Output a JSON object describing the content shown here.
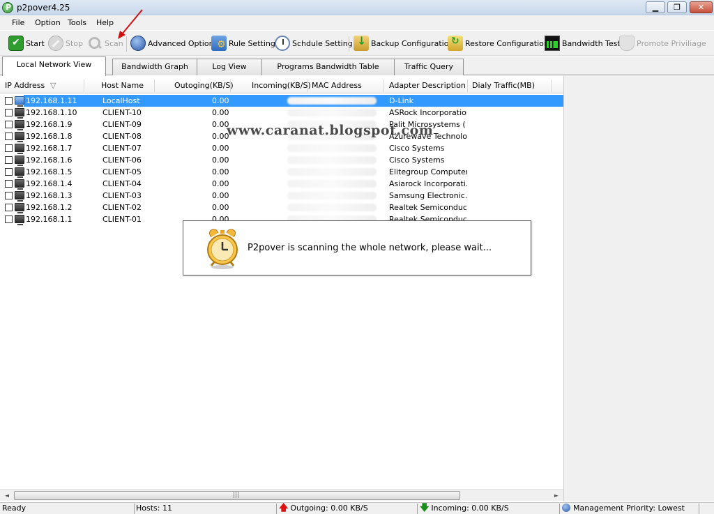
{
  "window": {
    "title": "p2pover4.25",
    "min": "0",
    "max": "1",
    "close": "r"
  },
  "menu": [
    "File",
    "Option",
    "Tools",
    "Help"
  ],
  "toolbar": {
    "start": "Start",
    "stop": "Stop",
    "scan": "Scan",
    "advanced_option": "Advanced Option",
    "rule_setting": "Rule Setting",
    "schedule_setting": "Schdule Setting",
    "backup_configuration": "Backup Configuration",
    "restore_configuration": "Restore Configuration",
    "bandwidth_test": "Bandwidth Test",
    "promote_privilege": "Promote Priviliage"
  },
  "tabs": [
    "Local Network View",
    "Bandwidth Graph",
    "Log View",
    "Programs Bandwidth Table",
    "Traffic Query"
  ],
  "active_tab": "Local Network View",
  "columns": [
    "IP Address",
    "Host Name",
    "Outoging(KB/S)",
    "Incoming(KB/S)",
    "MAC Address",
    "Adapter Description",
    "Dialy Traffic(MB)"
  ],
  "sort_indicator": "▽",
  "rows": [
    {
      "ip": "192.168.1.11",
      "host": "LocalHost",
      "out": "0.00",
      "adapter": "D-Link",
      "selected": true
    },
    {
      "ip": "192.168.1.10",
      "host": "CLIENT-10",
      "out": "0.00",
      "adapter": "ASRock Incorporation"
    },
    {
      "ip": "192.168.1.9",
      "host": "CLIENT-09",
      "out": "0.00",
      "adapter": "Palit Microsystems ( ..."
    },
    {
      "ip": "192.168.1.8",
      "host": "CLIENT-08",
      "out": "0.00",
      "adapter": "Azurewave Technology"
    },
    {
      "ip": "192.168.1.7",
      "host": "CLIENT-07",
      "out": "0.00",
      "adapter": "Cisco Systems"
    },
    {
      "ip": "192.168.1.6",
      "host": "CLIENT-06",
      "out": "0.00",
      "adapter": "Cisco Systems"
    },
    {
      "ip": "192.168.1.5",
      "host": "CLIENT-05",
      "out": "0.00",
      "adapter": "Elitegroup Computer ..."
    },
    {
      "ip": "192.168.1.4",
      "host": "CLIENT-04",
      "out": "0.00",
      "adapter": "Asiarock Incorporati..."
    },
    {
      "ip": "192.168.1.3",
      "host": "CLIENT-03",
      "out": "0.00",
      "adapter": "Samsung Electronic..."
    },
    {
      "ip": "192.168.1.2",
      "host": "CLIENT-02",
      "out": "0.00",
      "adapter": "Realtek Semiconduc..."
    },
    {
      "ip": "192.168.1.1",
      "host": "CLIENT-01",
      "out": "0.00",
      "adapter": "Realtek Semiconduc..."
    }
  ],
  "watermark": "www.caranat.blogspot.com",
  "scan_dialog": {
    "message": "P2pover is scanning the whole network, please wait..."
  },
  "scrollbar": {
    "left": "◄",
    "right": "►",
    "grip": "|||"
  },
  "status": {
    "ready": "Ready",
    "hosts": "Hosts: 11",
    "outgoing": "Outgoing: 0.00 KB/S",
    "incoming": "Incoming: 0.00 KB/S",
    "priority": "Management Priority: Lowest"
  },
  "colors": {
    "selection": "#3399ff",
    "accent_red": "#d11111",
    "accent_green": "#1a8f1a"
  }
}
